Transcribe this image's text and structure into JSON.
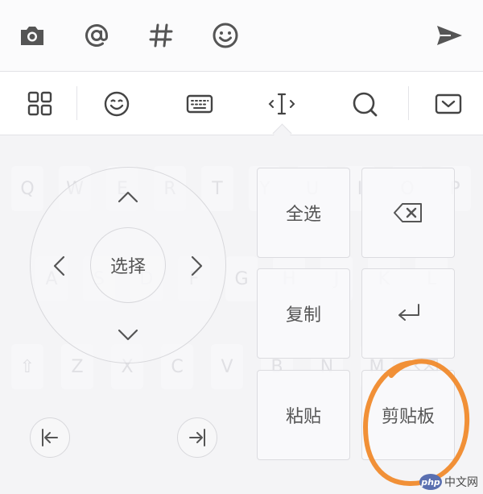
{
  "compose_bar": {
    "icons": [
      "camera-icon",
      "at-sign-icon",
      "hashtag-icon",
      "emoji-icon",
      "send-icon"
    ]
  },
  "keyboard_toolbar": {
    "icons": [
      "grid-menu-icon",
      "emoji-face-icon",
      "keyboard-icon",
      "cursor-text-icon",
      "search-icon",
      "collapse-keyboard-icon"
    ],
    "active": "cursor-text-icon"
  },
  "ghost_keys": {
    "row1": [
      "Q",
      "W",
      "E",
      "R",
      "T",
      "Y",
      "U",
      "I",
      "O",
      "P"
    ],
    "row2": [
      "A",
      "S",
      "D",
      "F",
      "G",
      "H",
      "J",
      "K",
      "L"
    ],
    "row3": [
      "⇧",
      "Z",
      "X",
      "C",
      "V",
      "B",
      "N",
      "M",
      "⌫"
    ]
  },
  "cursor_panel": {
    "select_label": "选择",
    "select_all_label": "全选",
    "copy_label": "复制",
    "paste_label": "粘贴",
    "clipboard_label": "剪贴板"
  },
  "watermark": {
    "logo": "php",
    "text": "中文网"
  },
  "colors": {
    "icon": "#555555",
    "highlight": "#f08a2c"
  }
}
